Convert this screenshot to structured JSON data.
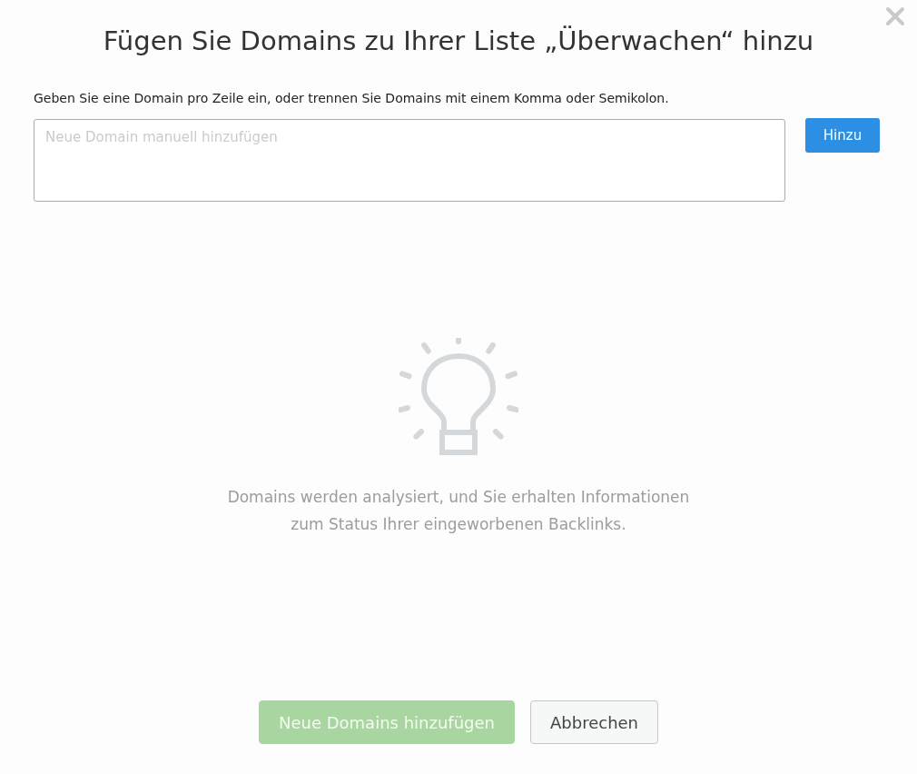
{
  "dialog": {
    "title": "Fügen Sie Domains zu Ihrer Liste „Überwachen“ hinzu",
    "instruction": "Geben Sie eine Domain pro Zeile ein, oder trennen Sie Domains mit einem Komma oder Semikolon.",
    "domain_field": {
      "placeholder": "Neue Domain manuell hinzufügen"
    },
    "add_button": "Hinzu",
    "empty_state": {
      "lines": [
        "Domains werden analysiert, und Sie erhalten Informationen",
        "zum Status Ihrer eingeworbenen Backlinks."
      ]
    },
    "buttons": [
      {
        "kind": "primary",
        "label": "Neue Domains hinzufügen",
        "disabled": true
      },
      {
        "kind": "secondary",
        "label": "Abbrechen",
        "disabled": false
      }
    ]
  }
}
